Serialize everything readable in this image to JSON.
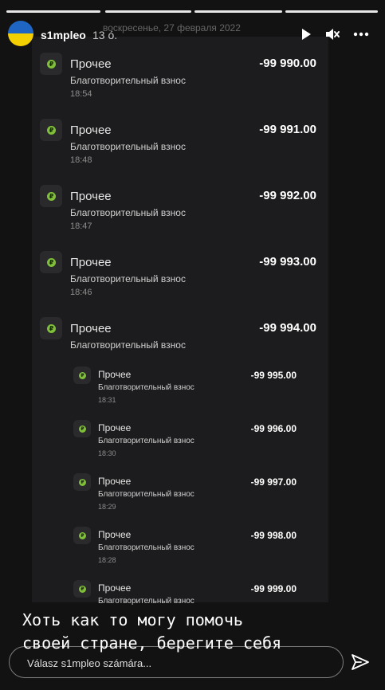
{
  "story": {
    "username": "s1mpleo",
    "posted_ago": "13 ó.",
    "avatar_flag": {
      "top": "#1f66c4",
      "bottom": "#f5d000"
    },
    "progress": {
      "segments": 4,
      "completed": 4
    },
    "controls": {
      "play_icon": "play-icon",
      "mute_icon": "muted-speaker-icon",
      "more_icon": "more-horizontal-icon"
    }
  },
  "screenshot": {
    "date_header": "воскресенье, 27 февраля 2022",
    "transactions": [
      {
        "category": "Прочее",
        "description": "Благотворительный взнос",
        "time": "18:54",
        "amount": "-99 990.00",
        "size": "big"
      },
      {
        "category": "Прочее",
        "description": "Благотворительный взнос",
        "time": "18:48",
        "amount": "-99 991.00",
        "size": "big"
      },
      {
        "category": "Прочее",
        "description": "Благотворительный взнос",
        "time": "18:47",
        "amount": "-99 992.00",
        "size": "big"
      },
      {
        "category": "Прочее",
        "description": "Благотворительный взнос",
        "time": "18:46",
        "amount": "-99 993.00",
        "size": "big"
      },
      {
        "category": "Прочее",
        "description": "Благотворительный взнос",
        "time": "",
        "amount": "-99 994.00",
        "size": "big"
      },
      {
        "category": "Прочее",
        "description": "Благотворительный взнос",
        "time": "18:31",
        "amount": "-99 995.00",
        "size": "small"
      },
      {
        "category": "Прочее",
        "description": "Благотворительный взнос",
        "time": "18:30",
        "amount": "-99 996.00",
        "size": "small"
      },
      {
        "category": "Прочее",
        "description": "Благотворительный взнос",
        "time": "18:29",
        "amount": "-99 997.00",
        "size": "small"
      },
      {
        "category": "Прочее",
        "description": "Благотворительный взнос",
        "time": "18:28",
        "amount": "-99 998.00",
        "size": "small"
      },
      {
        "category": "Прочее",
        "description": "Благотворительный взнос",
        "time": "",
        "amount": "-99 999.00",
        "size": "small"
      }
    ],
    "coin_symbol": "₽",
    "accent_color": "#7fbf3a"
  },
  "caption": {
    "line1": "Хоть как то могу помочь",
    "line2": "своей стране, берегите себя"
  },
  "reply": {
    "placeholder": "Válasz s1mpleo számára...",
    "send_icon": "send-paper-plane-icon"
  }
}
